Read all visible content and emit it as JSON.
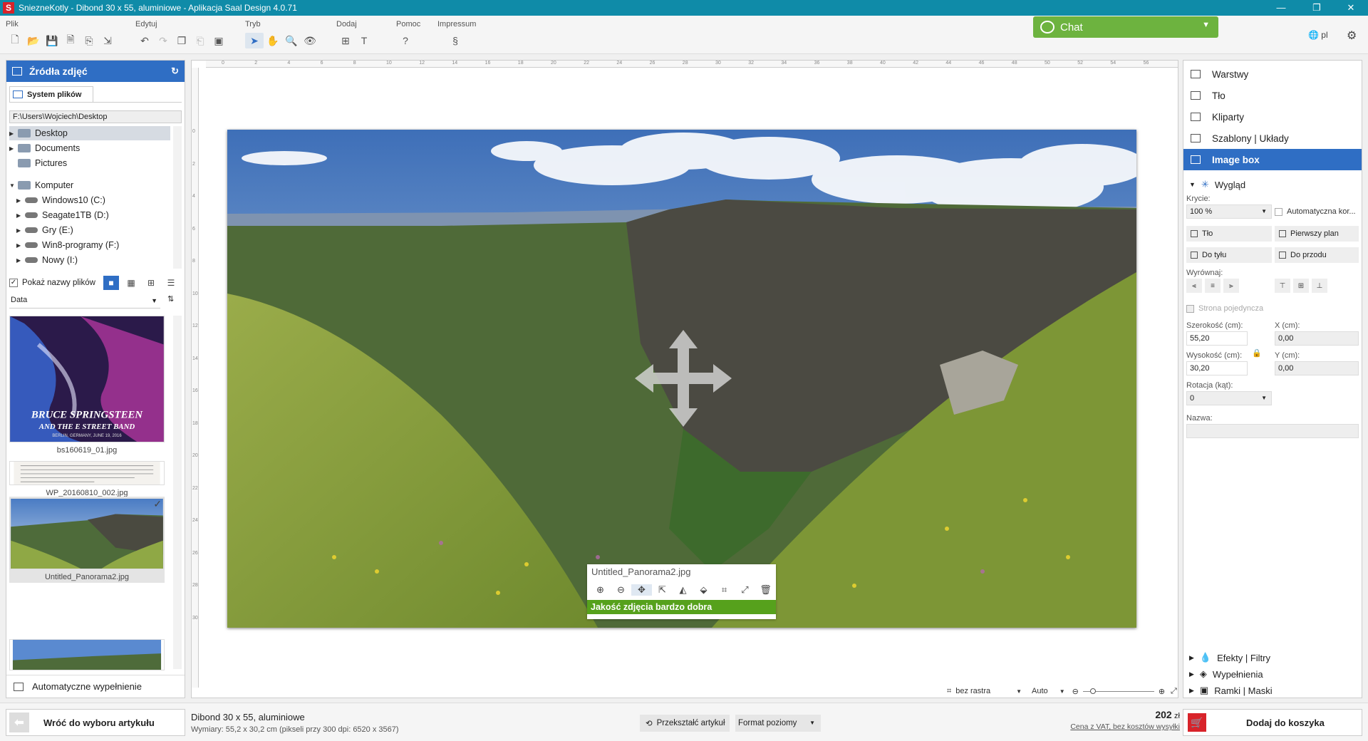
{
  "window": {
    "title": "SniezneKotly - Dibond 30 x 55, aluminiowe - Aplikacja Saal Design 4.0.71",
    "logo_letter": "S"
  },
  "window_controls": {
    "minimize": "—",
    "maximize": "❐",
    "close": "✕"
  },
  "menu": {
    "groups": [
      {
        "label": "Plik"
      },
      {
        "label": "Edytuj"
      },
      {
        "label": "Tryb"
      },
      {
        "label": "Dodaj"
      },
      {
        "label": "Pomoc",
        "icon_glyph": "?"
      },
      {
        "label": "Impressum",
        "icon_glyph": "§"
      }
    ]
  },
  "chat": {
    "label": "Chat",
    "accent": "#6db33f"
  },
  "language": {
    "code": "pl"
  },
  "left_panel": {
    "header": "Źródła zdjęć",
    "tab": "System plików",
    "path": "F:\\Users\\Wojciech\\Desktop",
    "tree": [
      {
        "label": "Desktop",
        "selected": true
      },
      {
        "label": "Documents"
      },
      {
        "label": "Pictures"
      },
      {
        "label": "Komputer"
      },
      {
        "label": "Windows10 (C:)"
      },
      {
        "label": "Seagate1TB (D:)"
      },
      {
        "label": "Gry (E:)"
      },
      {
        "label": "Win8-programy (F:)"
      },
      {
        "label": "Nowy (I:)"
      }
    ],
    "show_filenames": "Pokaż nazwy plików",
    "sort": "Data",
    "thumbnails": [
      {
        "caption": "bs160619_01.jpg",
        "band_line1": "BRUCE SPRINGSTEEN",
        "band_line2": "AND THE E STREET BAND",
        "band_line3": "BERLIN, GERMANY, JUNE 19, 2016"
      },
      {
        "caption": "WP_20160810_002.jpg"
      },
      {
        "caption": "Untitled_Panorama2.jpg",
        "selected": true
      },
      {
        "caption": ""
      }
    ],
    "autofill": "Automatyczne wypełnienie"
  },
  "canvas": {
    "ruler_h": [
      "0",
      "2",
      "4",
      "6",
      "8",
      "10",
      "12",
      "14",
      "16",
      "18",
      "20",
      "22",
      "24",
      "26",
      "28",
      "30",
      "32",
      "34",
      "36",
      "38",
      "40",
      "42",
      "44",
      "46",
      "48",
      "50",
      "52",
      "54",
      "56"
    ],
    "ruler_v": [
      "0",
      "2",
      "4",
      "6",
      "8",
      "10",
      "12",
      "14",
      "16",
      "18",
      "20",
      "22",
      "24",
      "26",
      "28",
      "30"
    ],
    "image_toolbar": {
      "filename": "Untitled_Panorama2.jpg",
      "quality": "Jakość zdjęcia bardzo dobra",
      "tools": [
        "zoom-in",
        "zoom-out",
        "move",
        "fit",
        "flip-h",
        "flip-v",
        "crop",
        "expand",
        "delete"
      ]
    },
    "zoom": {
      "raster": "bez rastra",
      "zoom_mode": "Auto"
    }
  },
  "right_panel": {
    "nav": [
      {
        "label": "Warstwy"
      },
      {
        "label": "Tło"
      },
      {
        "label": "Kliparty"
      },
      {
        "label": "Szablony | Układy"
      },
      {
        "label": "Image box",
        "active": true
      }
    ],
    "appearance": "Wygląd",
    "opacity_label": "Krycie:",
    "opacity_value": "100 %",
    "auto_color": "Automatyczna kor...",
    "order_buttons": [
      "Tło",
      "Pierwszy plan",
      "Do tyłu",
      "Do przodu"
    ],
    "align_label": "Wyrównaj:",
    "single_page": "Strona pojedyncza",
    "width_label": "Szerokość (cm):",
    "width_value": "55,20",
    "height_label": "Wysokość (cm):",
    "height_value": "30,20",
    "x_label": "X (cm):",
    "x_value": "0,00",
    "y_label": "Y (cm):",
    "y_value": "0,00",
    "rotation_label": "Rotacja (kąt):",
    "rotation_value": "0",
    "name_label": "Nazwa:",
    "name_value": "",
    "sections_bottom": [
      "Efekty | Filtry",
      "Wypełnienia",
      "Ramki | Maski"
    ]
  },
  "bottom": {
    "back": "Wróć do wyboru artykułu",
    "product_name": "Dibond 30 x 55, aluminiowe",
    "product_dims": "Wymiary: 55,2 x 30,2 cm (pikseli przy 300 dpi: 6520 x 3567)",
    "transform": "Przekształć artykuł",
    "format": "Format poziomy",
    "price": "202",
    "currency": "zł",
    "vat_note": "Cena z VAT, bez kosztów wysyłki",
    "cart": "Dodaj do koszyka"
  },
  "colors": {
    "accent_blue": "#2f6ec4",
    "titlebar": "#0f8ba8",
    "quality_green": "#56a11c",
    "cart_red": "#d8232a"
  }
}
